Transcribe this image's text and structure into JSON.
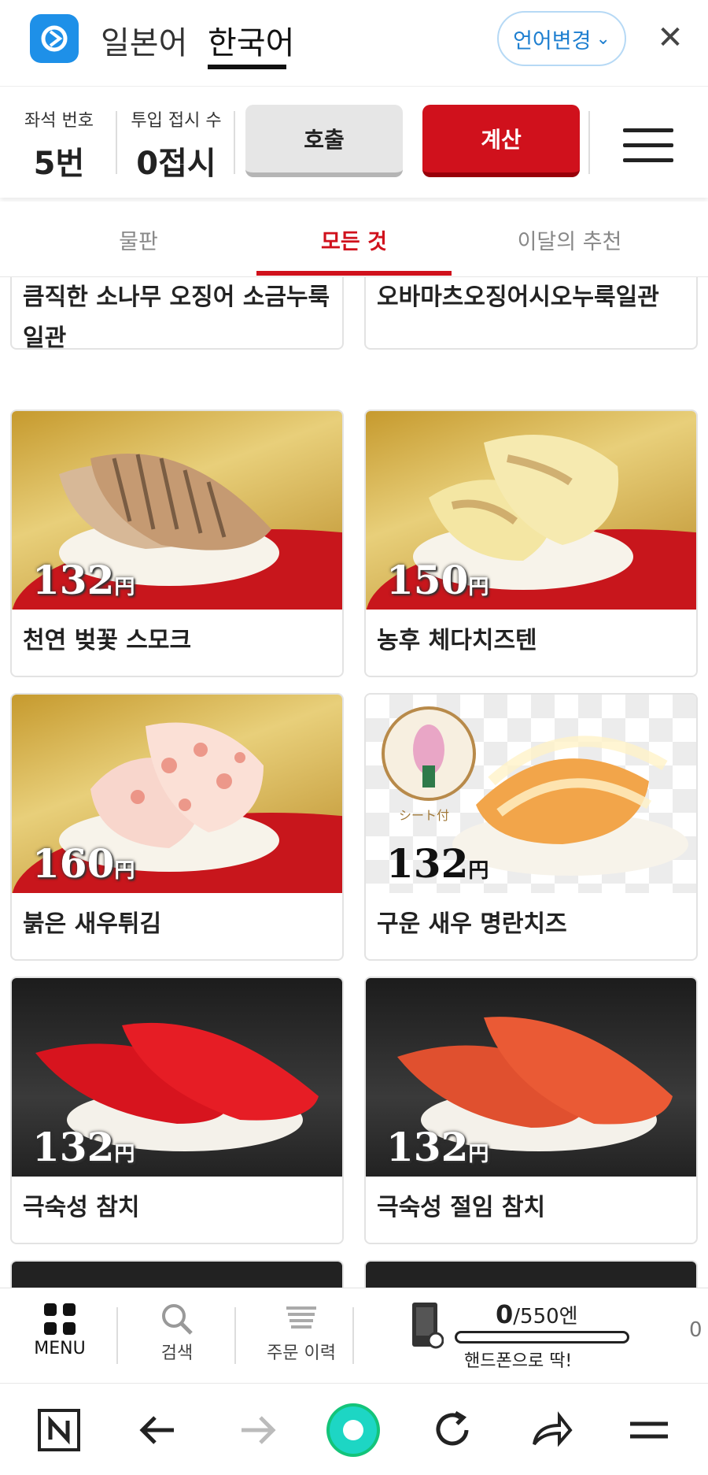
{
  "header": {
    "languages": [
      "일본어",
      "한국어"
    ],
    "active_language": "한국어",
    "change_language_label": "언어변경",
    "brand_color": "#1e90e8"
  },
  "seat": {
    "seat_label": "좌석 번호",
    "seat_value": "5번",
    "plates_label": "투입 접시 수",
    "plates_value": "0접시",
    "call_label": "호출",
    "bill_label": "계산",
    "accent": "#d0111c"
  },
  "tabs": [
    {
      "label": "물판"
    },
    {
      "label": "모든 것"
    },
    {
      "label": "이달의 추천"
    }
  ],
  "items": [
    {
      "name": "큼직한 소나무 오징어 소금누룩 일관",
      "price": ""
    },
    {
      "name": "오바마츠오징어시오누룩일관",
      "price": ""
    },
    {
      "name": "천연 벚꽃 스모크",
      "price": "132",
      "currency": "円"
    },
    {
      "name": "농후 체다치즈텐",
      "price": "150",
      "currency": "円"
    },
    {
      "name": "붉은 새우튀김",
      "price": "160",
      "currency": "円"
    },
    {
      "name": "구운 새우 명란치즈",
      "price": "132",
      "currency": "円",
      "badge": "シート付"
    },
    {
      "name": "극숙성 참치",
      "price": "132",
      "currency": "円"
    },
    {
      "name": "극숙성 절임 참치",
      "price": "132",
      "currency": "円"
    }
  ],
  "nav": {
    "menu_label": "MENU",
    "search_label": "검색",
    "history_label": "주문 이력",
    "points_current": "0",
    "points_total": "/550엔",
    "points_progress": 0,
    "points_caption": "핸드폰으로 딱!",
    "edge_value": "0"
  },
  "browser": {
    "icons": [
      "naver-icon",
      "back-arrow-icon",
      "forward-arrow-icon",
      "home-circle-icon",
      "refresh-icon",
      "share-icon",
      "menu-icon"
    ]
  }
}
